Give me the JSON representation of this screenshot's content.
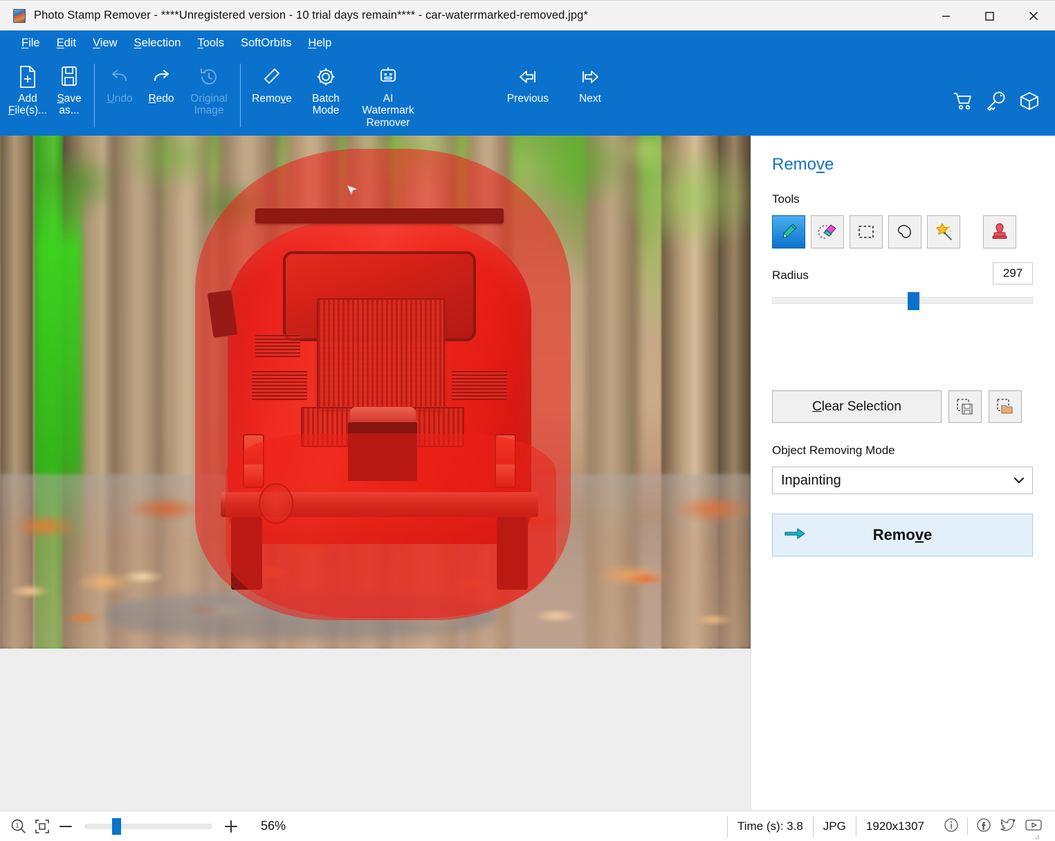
{
  "window": {
    "title": "Photo Stamp Remover - ****Unregistered version - 10 trial days remain**** - car-waterrmarked-removed.jpg*",
    "minimize_label": "Minimize",
    "maximize_label": "Maximize",
    "close_label": "Close"
  },
  "menubar": {
    "items": [
      {
        "label": "File",
        "accel": "F"
      },
      {
        "label": "Edit",
        "accel": "E"
      },
      {
        "label": "View",
        "accel": "V"
      },
      {
        "label": "Selection",
        "accel": "S"
      },
      {
        "label": "Tools",
        "accel": "T"
      },
      {
        "label": "SoftOrbits",
        "accel": ""
      },
      {
        "label": "Help",
        "accel": "H"
      }
    ]
  },
  "toolbar": {
    "items": [
      {
        "name": "add-files",
        "label_line1": "Add",
        "label_line2": "File(s)...",
        "icon": "document-add-icon",
        "disabled": false
      },
      {
        "name": "save-as",
        "label_line1": "Save",
        "label_line2": "as...",
        "icon": "floppy-save-icon",
        "disabled": false
      },
      {
        "name": "undo",
        "label_line1": "Undo",
        "label_line2": "",
        "icon": "undo-arrow-icon",
        "disabled": true
      },
      {
        "name": "redo",
        "label_line1": "Redo",
        "label_line2": "",
        "icon": "redo-arrow-icon",
        "disabled": false
      },
      {
        "name": "original-image",
        "label_line1": "Original",
        "label_line2": "Image",
        "icon": "history-clock-icon",
        "disabled": true
      },
      {
        "name": "remove",
        "label_line1": "Remove",
        "label_line2": "",
        "icon": "eraser-icon",
        "disabled": false
      },
      {
        "name": "batch-mode",
        "label_line1": "Batch",
        "label_line2": "Mode",
        "icon": "gear-icon",
        "disabled": false
      },
      {
        "name": "ai-watermark-remover",
        "label_line1": "AI",
        "label_line2": "Watermark",
        "label_line3": "Remover",
        "icon": "robot-icon",
        "disabled": false
      },
      {
        "name": "previous",
        "label_line1": "Previous",
        "label_line2": "",
        "icon": "arrow-left-icon",
        "disabled": false
      },
      {
        "name": "next",
        "label_line1": "Next",
        "label_line2": "",
        "icon": "arrow-right-icon",
        "disabled": false
      }
    ],
    "right_icons": [
      {
        "name": "cart-icon",
        "title": "Buy"
      },
      {
        "name": "key-icon",
        "title": "Register"
      },
      {
        "name": "box-icon",
        "title": "Products"
      }
    ]
  },
  "panel": {
    "title": "Remove",
    "tools_label": "Tools",
    "tools": [
      {
        "name": "brush-tool",
        "icon": "pencil-brush-icon",
        "active": true
      },
      {
        "name": "eraser-tool",
        "icon": "eraser-marker-icon",
        "active": false
      },
      {
        "name": "rectangle-select-tool",
        "icon": "dashed-rectangle-icon",
        "active": false
      },
      {
        "name": "lasso-tool",
        "icon": "lasso-icon",
        "active": false
      },
      {
        "name": "magic-wand-tool",
        "icon": "magic-wand-icon",
        "active": false
      },
      {
        "name": "clone-stamp-tool",
        "icon": "stamp-icon",
        "active": false
      }
    ],
    "radius_label": "Radius",
    "radius_value": "297",
    "radius_percent": 54,
    "clear_selection_label": "Clear Selection",
    "save_selection_name": "save-selection-icon",
    "open_selection_name": "open-selection-icon",
    "mode_label": "Object Removing Mode",
    "mode_value": "Inpainting",
    "mode_options": [
      "Inpainting"
    ],
    "remove_button_label": "Remove",
    "accent_color": "#0a72cd",
    "title_color": "#1473c4"
  },
  "statusbar": {
    "zoom_icon": "zoom-one-to-one-icon",
    "fit_icon": "fit-to-window-icon",
    "minus_label": "−",
    "plus_label": "+",
    "zoom_percent": "56%",
    "zoom_slider_percent": 25,
    "time_label": "Time (s): 3.8",
    "format_label": "JPG",
    "dimensions_label": "1920x1307",
    "social": [
      {
        "name": "info-icon"
      },
      {
        "name": "facebook-icon"
      },
      {
        "name": "twitter-icon"
      },
      {
        "name": "youtube-icon"
      }
    ]
  },
  "canvas": {
    "image_name": "car-waterrmarked-removed.jpg",
    "selection_color": "#ec2018",
    "description": "Red classic car on leaf-covered forest road with red selection mask overlay"
  }
}
